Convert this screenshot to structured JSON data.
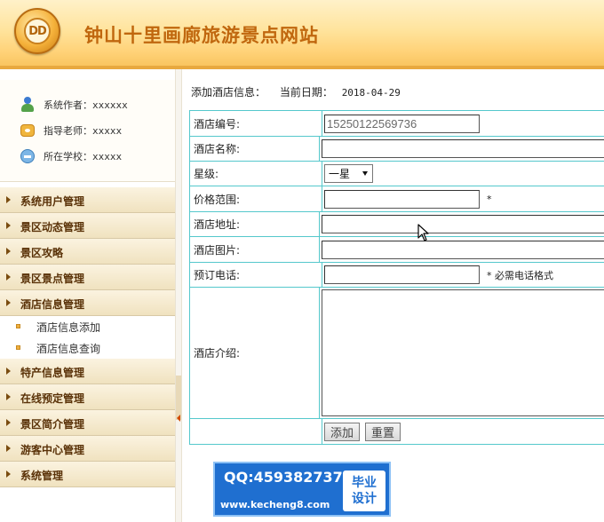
{
  "header": {
    "title": "钟山十里画廊旅游景点网站",
    "logo_text": "DD"
  },
  "sidebar": {
    "info": [
      {
        "label": "系统作者：xxxxxx",
        "icon": "user-icon"
      },
      {
        "label": "指导老师：xxxxx",
        "icon": "teacher-icon"
      },
      {
        "label": "所在学校：xxxxx",
        "icon": "school-icon"
      }
    ],
    "menu": [
      {
        "label": "系统用户管理"
      },
      {
        "label": "景区动态管理"
      },
      {
        "label": "景区攻略"
      },
      {
        "label": "景区景点管理"
      },
      {
        "label": "酒店信息管理",
        "sub": [
          "酒店信息添加",
          "酒店信息查询"
        ]
      },
      {
        "label": "特产信息管理"
      },
      {
        "label": "在线预定管理"
      },
      {
        "label": "景区简介管理"
      },
      {
        "label": "游客中心管理"
      },
      {
        "label": "系统管理"
      }
    ]
  },
  "main": {
    "page_label": "添加酒店信息：",
    "date_label": "当前日期：",
    "date_value": "2018-04-29",
    "form": {
      "hotel_id_label": "酒店编号:",
      "hotel_id_value": "15250122569736",
      "hotel_name_label": "酒店名称:",
      "star_label": "星级:",
      "star_value": "一星",
      "price_label": "价格范围:",
      "price_note": "*",
      "address_label": "酒店地址:",
      "image_label": "酒店图片:",
      "phone_label": "预订电话:",
      "phone_note": "* 必需电话格式",
      "intro_label": "酒店介绍:",
      "add_button": "添加",
      "reset_button": "重置"
    }
  },
  "watermark": {
    "qq": "QQ:459382737",
    "url": "www.kecheng8.com",
    "badge_line1": "毕业",
    "badge_line2": "设计"
  },
  "colors": {
    "header_gradient_top": "#fff1c9",
    "header_gradient_bottom": "#f7c25a",
    "title": "#c0670e",
    "table_border": "#55c8cc",
    "menu_text": "#5a3208",
    "watermark_bg": "#1f6fd0"
  }
}
